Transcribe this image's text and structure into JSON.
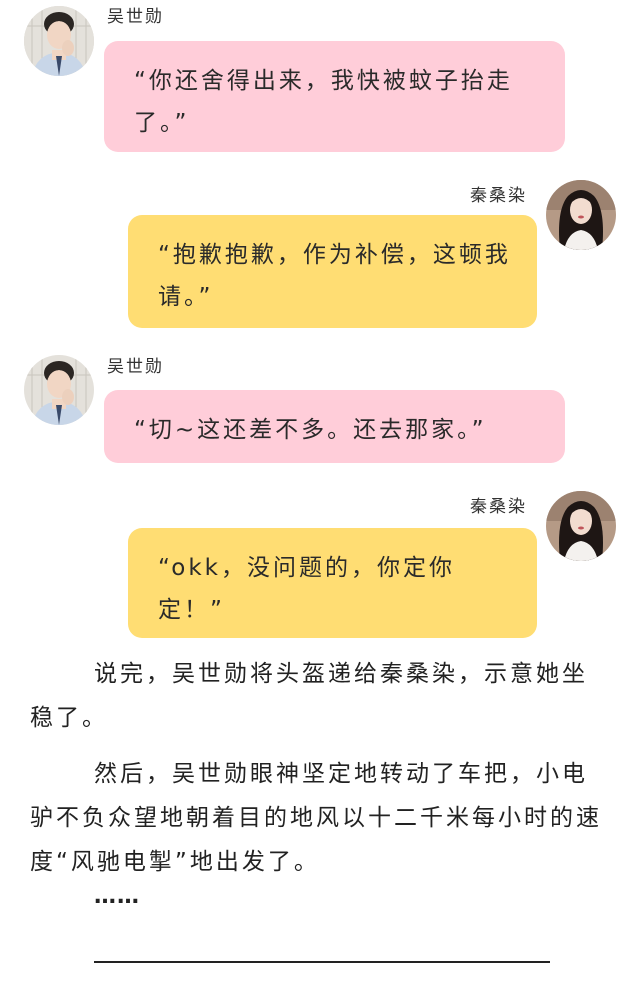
{
  "colors": {
    "wu_bubble": "#ffcdd9",
    "qin_bubble": "#ffdd73",
    "background": "#ffffff"
  },
  "messages": [
    {
      "sender": "吴世勋",
      "side": "left",
      "text": "“你还舍得出来，我快被蚊子抬走了。”"
    },
    {
      "sender": "秦桑染",
      "side": "right",
      "text": "“抱歉抱歉，作为补偿，这顿我请。”"
    },
    {
      "sender": "吴世勋",
      "side": "left",
      "text": "“切~这还差不多。还去那家。”"
    },
    {
      "sender": "秦桑染",
      "side": "right",
      "text": "“okk，没问题的，你定你定！”"
    }
  ],
  "narration": [
    "说完，吴世勋将头盔递给秦桑染，示意她坐稳了。",
    "然后，吴世勋眼神坚定地转动了车把，小电驴不负众望地朝着目的地风以十二千米每小时的速度“风驰电掣”地出发了。"
  ],
  "ellipsis": "……"
}
